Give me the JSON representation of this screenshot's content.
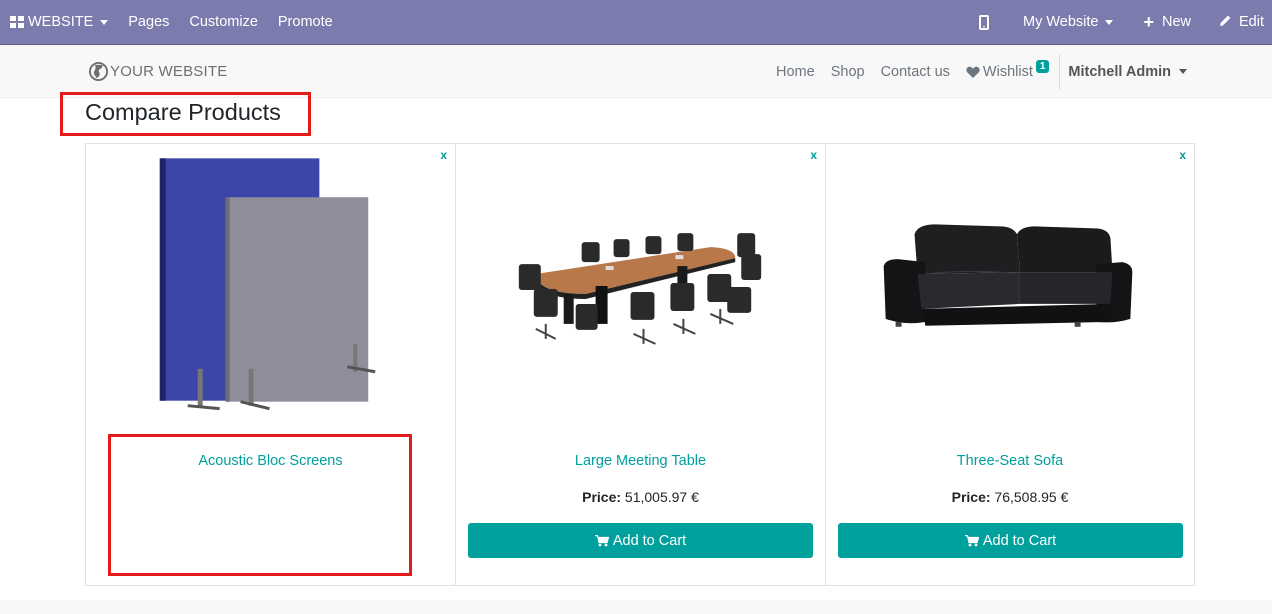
{
  "admin_bar": {
    "brand": "WEBSITE",
    "menu": [
      "Pages",
      "Customize",
      "Promote"
    ],
    "website_selector": "My Website",
    "new_label": "New",
    "edit_label": "Edit"
  },
  "header": {
    "logo_text": "YOUR WEBSITE",
    "nav": {
      "home": "Home",
      "shop": "Shop",
      "contact": "Contact us",
      "wishlist": "Wishlist",
      "wishlist_count": "1",
      "user": "Mitchell Admin"
    }
  },
  "page": {
    "title": "Compare Products"
  },
  "products": [
    {
      "name": "Acoustic Bloc Screens",
      "remove": "x",
      "price_label": "",
      "price": "",
      "button": ""
    },
    {
      "name": "Large Meeting Table",
      "remove": "x",
      "price_label": "Price:",
      "price": "51,005.97 €",
      "button": "Add to Cart"
    },
    {
      "name": "Three-Seat Sofa",
      "remove": "x",
      "price_label": "Price:",
      "price": "76,508.95 €",
      "button": "Add to Cart"
    }
  ],
  "colors": {
    "admin_bar": "#7c7bad",
    "accent": "#00a09d",
    "highlight": "#e31b1b"
  }
}
